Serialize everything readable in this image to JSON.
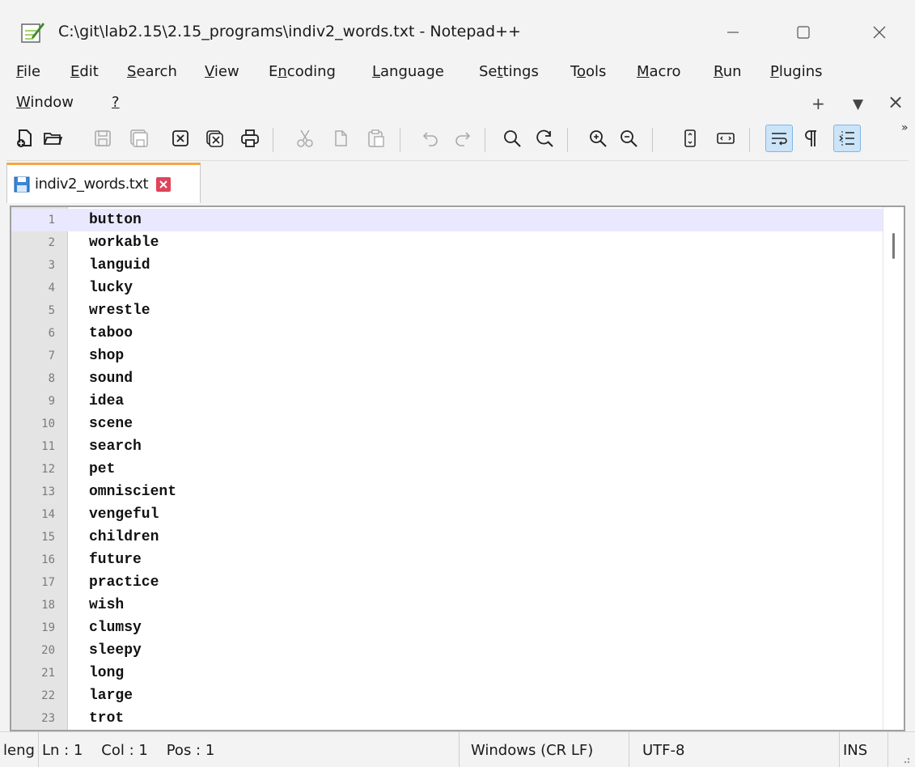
{
  "window": {
    "title": "C:\\git\\lab2.15\\2.15_programs\\indiv2_words.txt - Notepad++"
  },
  "menu": {
    "row1": [
      {
        "pre": "",
        "ul": "F",
        "post": "ile"
      },
      {
        "pre": "",
        "ul": "E",
        "post": "dit"
      },
      {
        "pre": "",
        "ul": "S",
        "post": "earch"
      },
      {
        "pre": "",
        "ul": "V",
        "post": "iew"
      },
      {
        "pre": "E",
        "ul": "n",
        "post": "coding"
      },
      {
        "pre": "",
        "ul": "L",
        "post": "anguage"
      },
      {
        "pre": "Se",
        "ul": "t",
        "post": "tings"
      },
      {
        "pre": "T",
        "ul": "o",
        "post": "ols"
      },
      {
        "pre": "",
        "ul": "M",
        "post": "acro"
      },
      {
        "pre": "",
        "ul": "R",
        "post": "un"
      },
      {
        "pre": "",
        "ul": "P",
        "post": "lugins"
      }
    ],
    "row2": [
      {
        "pre": "",
        "ul": "W",
        "post": "indow"
      },
      {
        "pre": "",
        "ul": "?",
        "post": ""
      }
    ],
    "right_plus": "+",
    "right_down": "▼",
    "right_close": "×"
  },
  "toolbar": {
    "more": "»"
  },
  "tab": {
    "label": "indiv2_words.txt"
  },
  "editor": {
    "lines": [
      "button",
      "workable",
      "languid",
      "lucky",
      "wrestle",
      "taboo",
      "shop",
      "sound",
      "idea",
      "scene",
      "search",
      "pet",
      "omniscient",
      "vengeful",
      "children",
      "future",
      "practice",
      "wish",
      "clumsy",
      "sleepy",
      "long",
      "large",
      "trot"
    ]
  },
  "status": {
    "length": "leng",
    "position": "Ln : 1    Col : 1    Pos : 1",
    "eol": "Windows (CR LF)",
    "encoding": "UTF-8",
    "mode": "INS"
  }
}
